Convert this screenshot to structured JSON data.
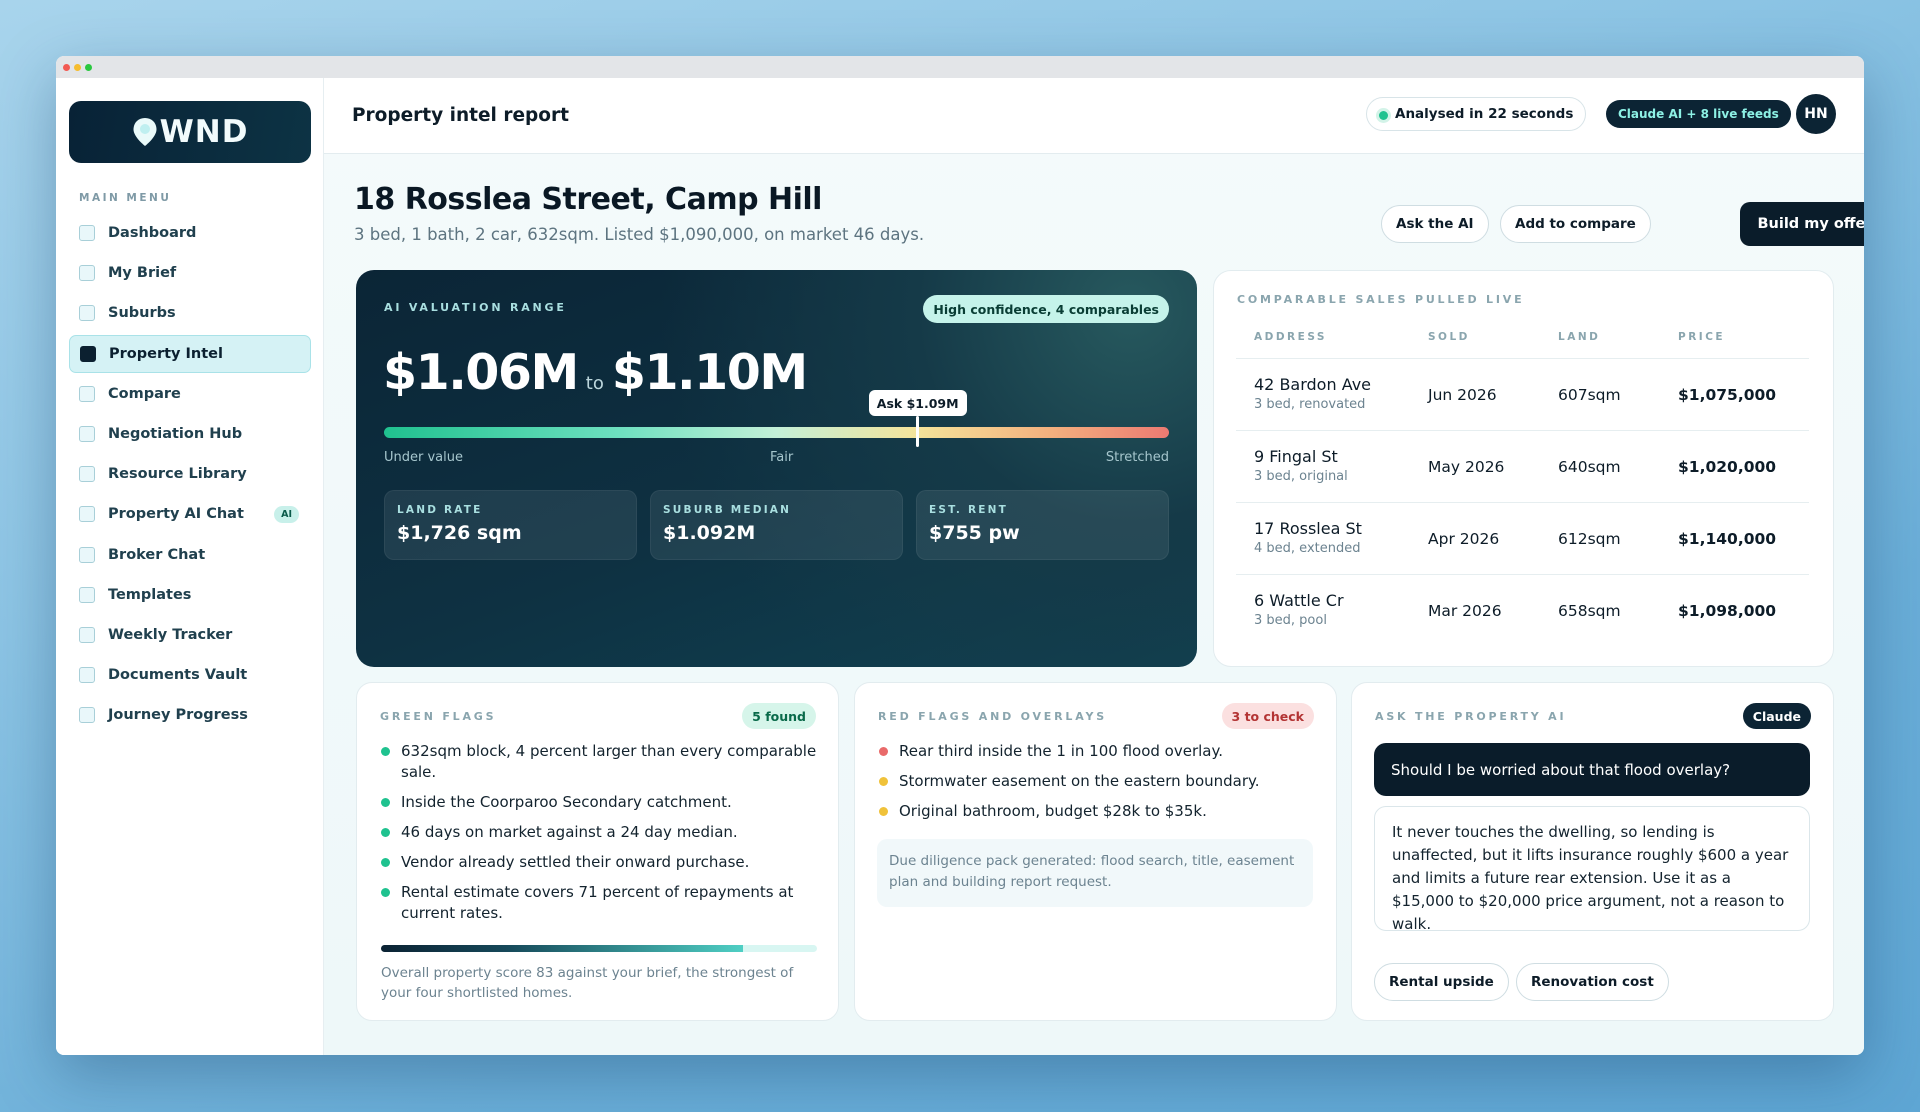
{
  "brand": {
    "logo_text": "WND"
  },
  "sidebar": {
    "heading": "MAIN MENU",
    "items": [
      {
        "label": "Dashboard"
      },
      {
        "label": "My Brief"
      },
      {
        "label": "Suburbs"
      },
      {
        "label": "Property Intel",
        "active": true
      },
      {
        "label": "Compare"
      },
      {
        "label": "Negotiation Hub"
      },
      {
        "label": "Resource Library"
      },
      {
        "label": "Property AI Chat",
        "badge": "AI"
      },
      {
        "label": "Broker Chat"
      },
      {
        "label": "Templates"
      },
      {
        "label": "Weekly Tracker"
      },
      {
        "label": "Documents Vault"
      },
      {
        "label": "Journey Progress"
      }
    ]
  },
  "header": {
    "title": "Property intel report",
    "analysed": "Analysed in 22 seconds",
    "feeds": "Claude AI + 8 live feeds",
    "avatar": "HN"
  },
  "property": {
    "title": "18 Rosslea Street, Camp Hill",
    "subtitle": "3 bed, 1 bath, 2 car, 632sqm. Listed $1,090,000, on market 46 days.",
    "actions": {
      "ask": "Ask the AI",
      "compare": "Add to compare",
      "offer": "Build my offer"
    }
  },
  "valuation": {
    "label": "AI VALUATION RANGE",
    "confidence": "High confidence, 4 comparables",
    "low": "$1.06M",
    "to": "to",
    "high": "$1.10M",
    "ask_tag": "Ask $1.09M",
    "ask_position": 0.68,
    "scale": {
      "left": "Under value",
      "mid": "Fair",
      "right": "Stretched"
    },
    "stats": [
      {
        "key": "LAND RATE",
        "value": "$1,726 sqm"
      },
      {
        "key": "SUBURB MEDIAN",
        "value": "$1.092M"
      },
      {
        "key": "EST. RENT",
        "value": "$755 pw"
      }
    ]
  },
  "comparables": {
    "label": "COMPARABLE SALES PULLED LIVE",
    "headers": {
      "address": "ADDRESS",
      "sold": "SOLD",
      "land": "LAND",
      "price": "PRICE"
    },
    "rows": [
      {
        "address": "42 Bardon Ave",
        "note": "3 bed, renovated",
        "sold": "Jun 2026",
        "land": "607sqm",
        "price": "$1,075,000"
      },
      {
        "address": "9 Fingal St",
        "note": "3 bed, original",
        "sold": "May 2026",
        "land": "640sqm",
        "price": "$1,020,000"
      },
      {
        "address": "17 Rosslea St",
        "note": "4 bed, extended",
        "sold": "Apr 2026",
        "land": "612sqm",
        "price": "$1,140,000"
      },
      {
        "address": "6 Wattle Cr",
        "note": "3 bed, pool",
        "sold": "Mar 2026",
        "land": "658sqm",
        "price": "$1,098,000"
      }
    ]
  },
  "green_flags": {
    "label": "GREEN FLAGS",
    "badge": "5 found",
    "items": [
      "632sqm block, 4 percent larger than every comparable sale.",
      "Inside the Coorparoo Secondary catchment.",
      "46 days on market against a 24 day median.",
      "Vendor already settled their onward purchase.",
      "Rental estimate covers 71 percent of repayments at current rates."
    ],
    "score": 83,
    "score_text": "Overall property score 83 against your brief, the strongest of your four shortlisted homes."
  },
  "red_flags": {
    "label": "RED FLAGS AND OVERLAYS",
    "badge": "3 to check",
    "items": [
      {
        "text": "Rear third inside the 1 in 100 flood overlay.",
        "color": "#e96a6a"
      },
      {
        "text": "Stormwater easement on the eastern boundary.",
        "color": "#f0c23a"
      },
      {
        "text": "Original bathroom, budget $28k to $35k.",
        "color": "#f0c23a"
      }
    ],
    "note": "Due diligence pack generated: flood search, title, easement plan and building report request."
  },
  "ask_ai": {
    "label": "ASK THE PROPERTY AI",
    "badge": "Claude",
    "question": "Should I be worried about that flood overlay?",
    "answer": "It never touches the dwelling, so lending is unaffected, but it lifts insurance roughly $600 a year and limits a future rear extension. Use it as a $15,000 to $20,000 price argument, not a reason to walk.",
    "chips": [
      "Rental upside",
      "Renovation cost"
    ]
  },
  "colors": {
    "accent": "#0c2434",
    "green": "#1fc28f",
    "teal": "#c5f3ea"
  }
}
